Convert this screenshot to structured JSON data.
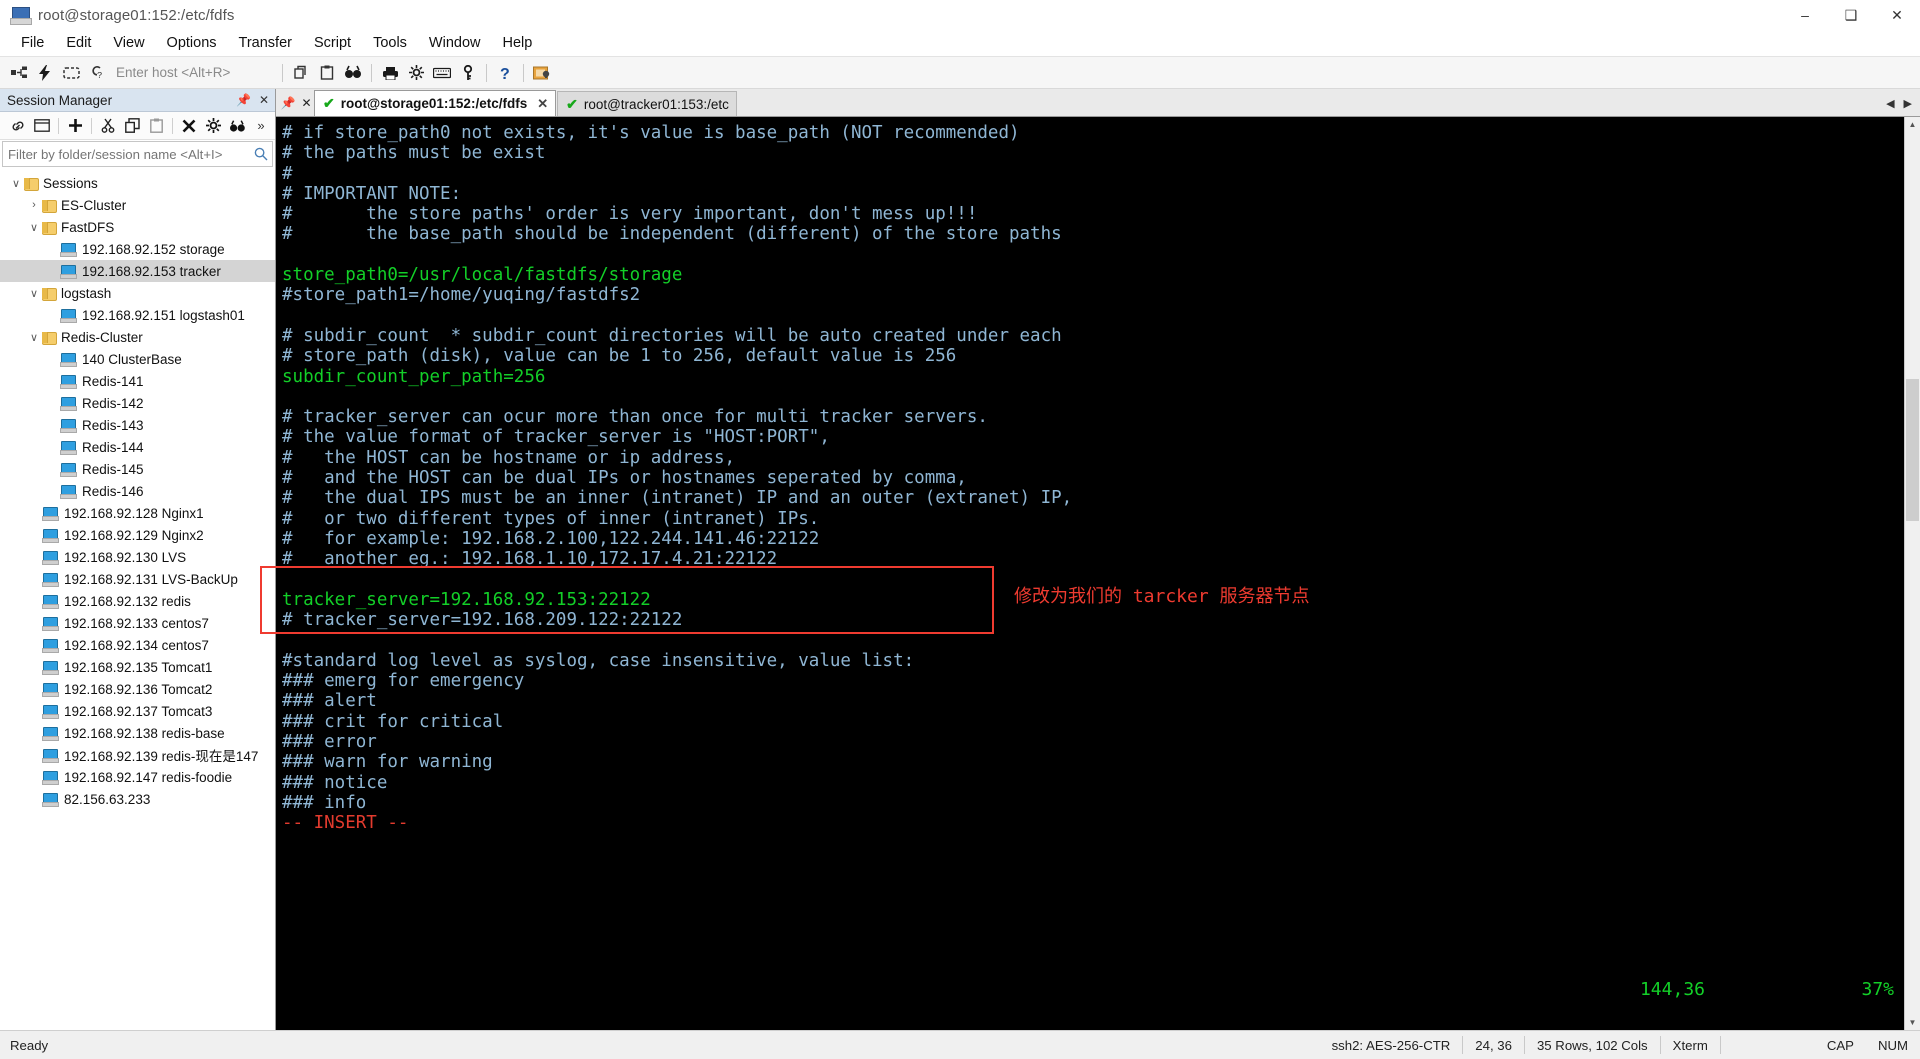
{
  "window": {
    "title": "root@storage01:152:/etc/fdfs",
    "app_icon": "terminal-app-icon",
    "minimize": "–",
    "maximize": "❑",
    "close": "✕"
  },
  "menubar": {
    "items": [
      "File",
      "Edit",
      "View",
      "Options",
      "Transfer",
      "Script",
      "Tools",
      "Window",
      "Help"
    ]
  },
  "toolbar": {
    "host_placeholder": "Enter host <Alt+R>",
    "icons": [
      "connect-icon",
      "quick-connect-icon",
      "reconnect-icon",
      "connect-sftp-icon",
      "copy-session-icon",
      "paste-session-icon",
      "find-icon",
      "print-icon",
      "settings-icon",
      "keymap-icon",
      "key-icon",
      "help-icon",
      "lock-icon"
    ]
  },
  "session_manager": {
    "title": "Session Manager",
    "pin_icon": "pin-icon",
    "close_icon": "close-icon",
    "tool_icons": [
      "link-icon",
      "new-window-icon",
      "add-icon",
      "cut-icon",
      "copy-icon",
      "paste-icon",
      "delete-icon",
      "properties-icon",
      "find-session-icon",
      "overflow-icon"
    ],
    "filter_placeholder": "Filter by folder/session name <Alt+I>",
    "search_icon": "search-icon",
    "tree": [
      {
        "label": "Sessions",
        "type": "folder",
        "depth": 0,
        "expanded": true,
        "selected": false
      },
      {
        "label": "ES-Cluster",
        "type": "folder",
        "depth": 1,
        "expanded": false,
        "selected": false
      },
      {
        "label": "FastDFS",
        "type": "folder",
        "depth": 1,
        "expanded": true,
        "selected": false
      },
      {
        "label": "192.168.92.152 storage",
        "type": "session",
        "depth": 2,
        "selected": false
      },
      {
        "label": "192.168.92.153 tracker",
        "type": "session",
        "depth": 2,
        "selected": true
      },
      {
        "label": "logstash",
        "type": "folder",
        "depth": 1,
        "expanded": true,
        "selected": false
      },
      {
        "label": "192.168.92.151 logstash01",
        "type": "session",
        "depth": 2,
        "selected": false
      },
      {
        "label": "Redis-Cluster",
        "type": "folder",
        "depth": 1,
        "expanded": true,
        "selected": false
      },
      {
        "label": "140 ClusterBase",
        "type": "session",
        "depth": 2,
        "selected": false
      },
      {
        "label": "Redis-141",
        "type": "session",
        "depth": 2,
        "selected": false
      },
      {
        "label": "Redis-142",
        "type": "session",
        "depth": 2,
        "selected": false
      },
      {
        "label": "Redis-143",
        "type": "session",
        "depth": 2,
        "selected": false
      },
      {
        "label": "Redis-144",
        "type": "session",
        "depth": 2,
        "selected": false
      },
      {
        "label": "Redis-145",
        "type": "session",
        "depth": 2,
        "selected": false
      },
      {
        "label": "Redis-146",
        "type": "session",
        "depth": 2,
        "selected": false
      },
      {
        "label": "192.168.92.128 Nginx1",
        "type": "session",
        "depth": 1,
        "selected": false
      },
      {
        "label": "192.168.92.129 Nginx2",
        "type": "session",
        "depth": 1,
        "selected": false
      },
      {
        "label": "192.168.92.130 LVS",
        "type": "session",
        "depth": 1,
        "selected": false
      },
      {
        "label": "192.168.92.131 LVS-BackUp",
        "type": "session",
        "depth": 1,
        "selected": false
      },
      {
        "label": "192.168.92.132 redis",
        "type": "session",
        "depth": 1,
        "selected": false
      },
      {
        "label": "192.168.92.133 centos7",
        "type": "session",
        "depth": 1,
        "selected": false
      },
      {
        "label": "192.168.92.134 centos7",
        "type": "session",
        "depth": 1,
        "selected": false
      },
      {
        "label": "192.168.92.135 Tomcat1",
        "type": "session",
        "depth": 1,
        "selected": false
      },
      {
        "label": "192.168.92.136 Tomcat2",
        "type": "session",
        "depth": 1,
        "selected": false
      },
      {
        "label": "192.168.92.137 Tomcat3",
        "type": "session",
        "depth": 1,
        "selected": false
      },
      {
        "label": "192.168.92.138 redis-base",
        "type": "session",
        "depth": 1,
        "selected": false
      },
      {
        "label": "192.168.92.139 redis-现在是147",
        "type": "session",
        "depth": 1,
        "selected": false
      },
      {
        "label": "192.168.92.147 redis-foodie",
        "type": "session",
        "depth": 1,
        "selected": false
      },
      {
        "label": "82.156.63.233",
        "type": "session",
        "depth": 1,
        "selected": false
      }
    ]
  },
  "tabs": {
    "pin_icon": "pin-icon",
    "close_icon": "close-icon",
    "items": [
      {
        "label": "root@storage01:152:/etc/fdfs",
        "active": true,
        "status": "connected",
        "close": "✕"
      },
      {
        "label": "root@tracker01:153:/etc",
        "active": false,
        "status": "connected",
        "close": ""
      }
    ],
    "nav_prev": "◀",
    "nav_next": "▶"
  },
  "terminal": {
    "lines": [
      {
        "text": "# if store_path0 not exists, it's value is base_path (NOT recommended)",
        "color": "comment"
      },
      {
        "text": "# the paths must be exist",
        "color": "comment"
      },
      {
        "text": "#",
        "color": "comment"
      },
      {
        "text": "# IMPORTANT NOTE:",
        "color": "comment"
      },
      {
        "text": "#       the store paths' order is very important, don't mess up!!!",
        "color": "comment"
      },
      {
        "text": "#       the base_path should be independent (different) of the store paths",
        "color": "comment"
      },
      {
        "text": "",
        "color": "comment"
      },
      {
        "text": "store_path0=/usr/local/fastdfs/storage",
        "color": "green"
      },
      {
        "text": "#store_path1=/home/yuqing/fastdfs2",
        "color": "comment"
      },
      {
        "text": "",
        "color": "comment"
      },
      {
        "text": "# subdir_count  * subdir_count directories will be auto created under each",
        "color": "comment"
      },
      {
        "text": "# store_path (disk), value can be 1 to 256, default value is 256",
        "color": "comment"
      },
      {
        "text": "subdir_count_per_path=256",
        "color": "green"
      },
      {
        "text": "",
        "color": "comment"
      },
      {
        "text": "# tracker_server can ocur more than once for multi tracker servers.",
        "color": "comment"
      },
      {
        "text": "# the value format of tracker_server is \"HOST:PORT\",",
        "color": "comment"
      },
      {
        "text": "#   the HOST can be hostname or ip address,",
        "color": "comment"
      },
      {
        "text": "#   and the HOST can be dual IPs or hostnames seperated by comma,",
        "color": "comment"
      },
      {
        "text": "#   the dual IPS must be an inner (intranet) IP and an outer (extranet) IP,",
        "color": "comment"
      },
      {
        "text": "#   or two different types of inner (intranet) IPs.",
        "color": "comment"
      },
      {
        "text": "#   for example: 192.168.2.100,122.244.141.46:22122",
        "color": "comment"
      },
      {
        "text": "#   another eg.: 192.168.1.10,172.17.4.21:22122",
        "color": "comment"
      },
      {
        "text": "",
        "color": "comment"
      },
      {
        "text": "tracker_server=192.168.92.153:22122",
        "color": "green"
      },
      {
        "text": "# tracker_server=192.168.209.122:22122",
        "color": "comment"
      },
      {
        "text": "",
        "color": "comment"
      },
      {
        "text": "#standard log level as syslog, case insensitive, value list:",
        "color": "comment"
      },
      {
        "text": "### emerg for emergency",
        "color": "comment"
      },
      {
        "text": "### alert",
        "color": "comment"
      },
      {
        "text": "### crit for critical",
        "color": "comment"
      },
      {
        "text": "### error",
        "color": "comment"
      },
      {
        "text": "### warn for warning",
        "color": "comment"
      },
      {
        "text": "### notice",
        "color": "comment"
      },
      {
        "text": "### info",
        "color": "comment"
      },
      {
        "text": "-- INSERT --",
        "color": "red"
      }
    ],
    "cursor_position": "144,36",
    "scroll_percent": "37%",
    "annotation_text": "修改为我们的 tarcker 服务器节点",
    "annotation_color": "#ef3b30"
  },
  "statusbar": {
    "ready": "Ready",
    "protocol": "ssh2: AES-256-CTR",
    "cursor": "24, 36",
    "size": "35 Rows, 102 Cols",
    "emulation": "Xterm",
    "cap": "CAP",
    "num": "NUM"
  }
}
